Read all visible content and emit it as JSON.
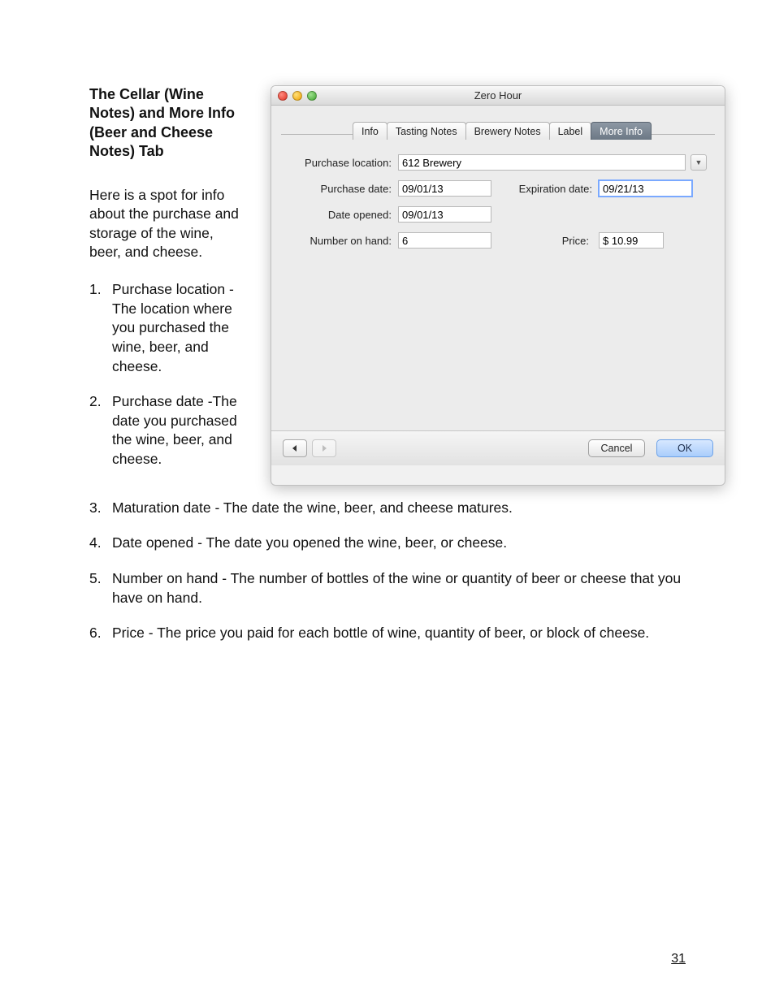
{
  "doc": {
    "heading": "The Cellar (Wine Notes) and More Info (Beer and Cheese Notes) Tab",
    "intro": "Here is a spot for info about the purchase and storage of the wine, beer, and cheese.",
    "list": [
      {
        "num": "1.",
        "text": "Purchase location - The location where you purchased the wine, beer, and cheese."
      },
      {
        "num": "2.",
        "text": "Purchase date -The date you purchased the wine, beer, and cheese."
      },
      {
        "num": "3.",
        "text": "Maturation date - The date the wine, beer, and cheese matures."
      },
      {
        "num": "4.",
        "text": "Date opened - The date you opened the wine, beer, or cheese."
      },
      {
        "num": "5.",
        "text": "Number on hand - The number of bottles of the wine or quantity of beer or cheese that you have on hand."
      },
      {
        "num": "6.",
        "text": "Price - The price you paid for each bottle of wine, quantity of beer, or block of cheese."
      }
    ],
    "page_number": "31"
  },
  "window": {
    "title": "Zero Hour",
    "tabs": [
      "Info",
      "Tasting Notes",
      "Brewery Notes",
      "Label",
      "More Info"
    ],
    "active_tab": "More Info",
    "form": {
      "purchase_location_label": "Purchase location:",
      "purchase_location_value": "612 Brewery",
      "purchase_date_label": "Purchase date:",
      "purchase_date_value": "09/01/13",
      "expiration_date_label": "Expiration date:",
      "expiration_date_value": "09/21/13",
      "date_opened_label": "Date opened:",
      "date_opened_value": "09/01/13",
      "number_on_hand_label": "Number on hand:",
      "number_on_hand_value": "6",
      "price_label": "Price:",
      "price_value": "$ 10.99"
    },
    "buttons": {
      "cancel": "Cancel",
      "ok": "OK"
    }
  }
}
